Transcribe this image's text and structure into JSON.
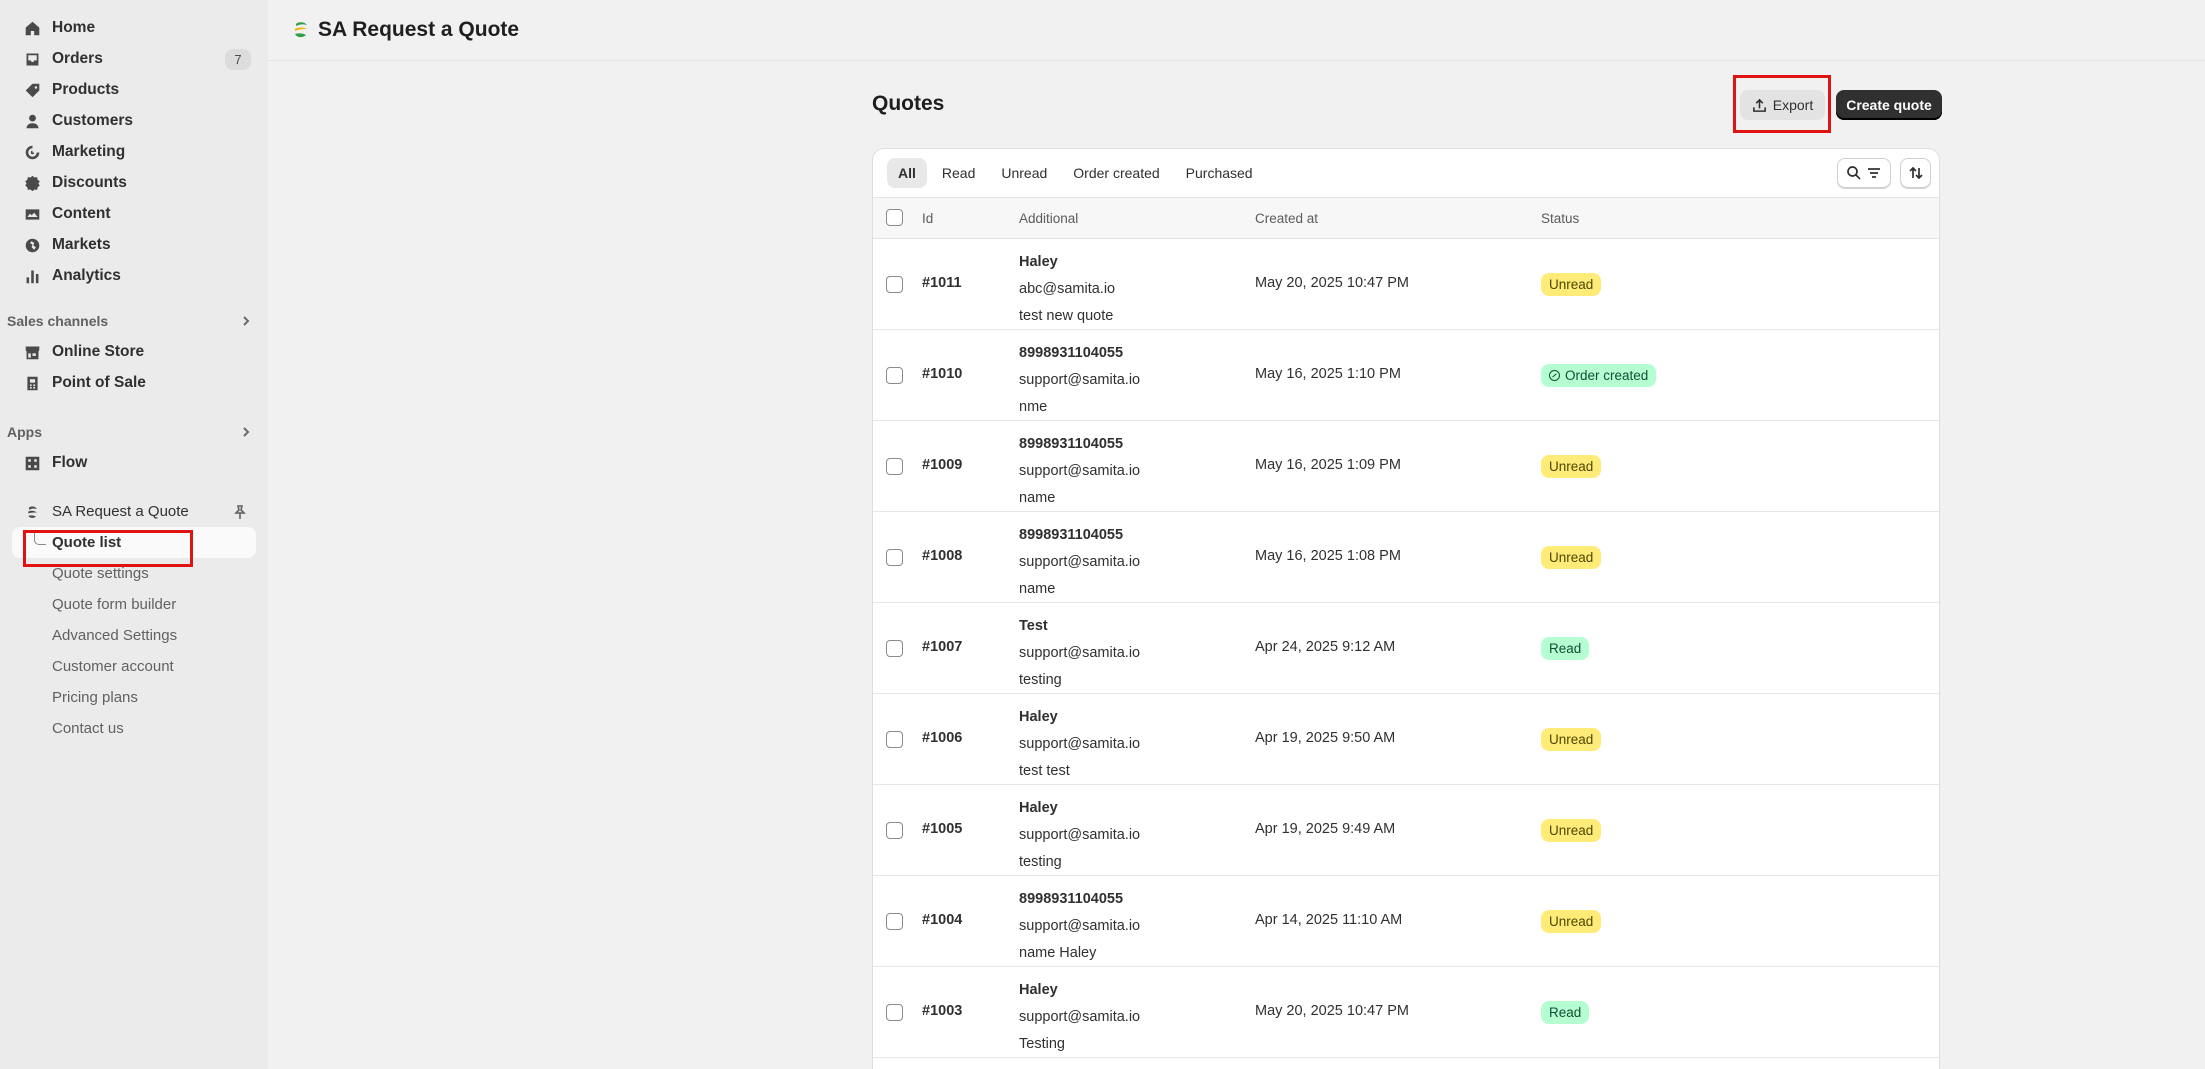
{
  "sidebar": {
    "nav": [
      {
        "label": "Home",
        "icon": "home-icon"
      },
      {
        "label": "Orders",
        "icon": "orders-icon",
        "count": "7"
      },
      {
        "label": "Products",
        "icon": "tag-icon"
      },
      {
        "label": "Customers",
        "icon": "person-icon"
      },
      {
        "label": "Marketing",
        "icon": "target-icon"
      },
      {
        "label": "Discounts",
        "icon": "discount-icon"
      },
      {
        "label": "Content",
        "icon": "image-icon"
      },
      {
        "label": "Markets",
        "icon": "globe-icon"
      },
      {
        "label": "Analytics",
        "icon": "bar-chart-icon"
      }
    ],
    "sales_channels": {
      "heading": "Sales channels",
      "items": [
        {
          "label": "Online Store",
          "icon": "store-icon"
        },
        {
          "label": "Point of Sale",
          "icon": "pos-icon"
        }
      ]
    },
    "apps": {
      "heading": "Apps",
      "items": [
        {
          "label": "Flow",
          "icon": "flow-icon"
        }
      ]
    },
    "app": {
      "label": "SA Request a Quote",
      "sub_items": [
        {
          "label": "Quote list",
          "active": true
        },
        {
          "label": "Quote settings"
        },
        {
          "label": "Quote form builder"
        },
        {
          "label": "Advanced Settings"
        },
        {
          "label": "Customer account"
        },
        {
          "label": "Pricing plans"
        },
        {
          "label": "Contact us"
        }
      ]
    }
  },
  "header": {
    "title": "SA Request a Quote"
  },
  "page": {
    "title": "Quotes",
    "export_label": "Export",
    "create_label": "Create quote"
  },
  "tabs": [
    "All",
    "Read",
    "Unread",
    "Order created",
    "Purchased"
  ],
  "table": {
    "columns": {
      "id": "Id",
      "additional": "Additional",
      "created_at": "Created at",
      "status": "Status"
    },
    "rows": [
      {
        "id": "#1011",
        "name": "Haley",
        "email": "abc@samita.io",
        "note": "test new quote",
        "created_at": "May 20, 2025 10:47 PM",
        "status": "Unread"
      },
      {
        "id": "#1010",
        "name": "8998931104055",
        "email": "support@samita.io",
        "note": "nme",
        "created_at": "May 16, 2025 1:10 PM",
        "status": "Order created"
      },
      {
        "id": "#1009",
        "name": "8998931104055",
        "email": "support@samita.io",
        "note": "name",
        "created_at": "May 16, 2025 1:09 PM",
        "status": "Unread"
      },
      {
        "id": "#1008",
        "name": "8998931104055",
        "email": "support@samita.io",
        "note": "name",
        "created_at": "May 16, 2025 1:08 PM",
        "status": "Unread"
      },
      {
        "id": "#1007",
        "name": "Test",
        "email": "support@samita.io",
        "note": "testing",
        "created_at": "Apr 24, 2025 9:12 AM",
        "status": "Read"
      },
      {
        "id": "#1006",
        "name": "Haley",
        "email": "support@samita.io",
        "note": "test test",
        "created_at": "Apr 19, 2025 9:50 AM",
        "status": "Unread"
      },
      {
        "id": "#1005",
        "name": "Haley",
        "email": "support@samita.io",
        "note": "testing",
        "created_at": "Apr 19, 2025 9:49 AM",
        "status": "Unread"
      },
      {
        "id": "#1004",
        "name": "8998931104055",
        "email": "support@samita.io",
        "note": "name Haley",
        "created_at": "Apr 14, 2025 11:10 AM",
        "status": "Unread"
      },
      {
        "id": "#1003",
        "name": "Haley",
        "email": "support@samita.io",
        "note": "Testing",
        "created_at": "May 20, 2025 10:47 PM",
        "status": "Read"
      }
    ]
  },
  "colors": {
    "unread_badge": "#ffeb78",
    "read_badge": "#b4fed2",
    "primary_button": "#303030",
    "highlight": "#e01313"
  }
}
